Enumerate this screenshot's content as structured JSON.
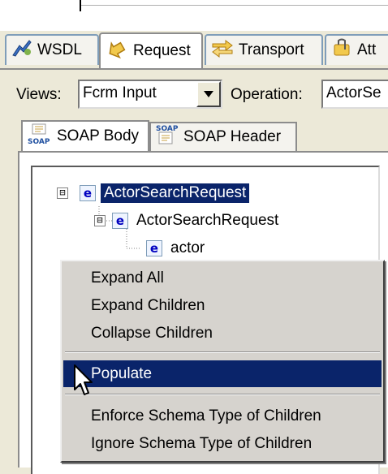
{
  "outer_tabs": [
    {
      "label": "WSDL",
      "icon": "wsdl-icon"
    },
    {
      "label": "Request",
      "icon": "request-icon",
      "active": true
    },
    {
      "label": "Transport",
      "icon": "transport-icon"
    },
    {
      "label": "Att",
      "icon": "attachments-icon"
    }
  ],
  "views": {
    "label": "Views:",
    "selected": "Fcrm Input",
    "operation_label": "Operation:",
    "operation_value": "ActorSe"
  },
  "inner_tabs": [
    {
      "label": "SOAP Body",
      "icon": "soap-icon",
      "active": true
    },
    {
      "label": "SOAP Header",
      "icon": "soap-icon"
    }
  ],
  "tree": {
    "root": {
      "label": "ActorSearchRequest",
      "expander": "⊟"
    },
    "child": {
      "label": "ActorSearchRequest",
      "expander": "⊟"
    },
    "grandchild": {
      "label": "actor"
    },
    "element_icon_glyph": "e"
  },
  "context_menu": {
    "items": [
      {
        "label": "Expand All"
      },
      {
        "label": "Expand Children"
      },
      {
        "label": "Collapse Children"
      },
      {
        "label": "Populate",
        "highlighted": true
      },
      {
        "label": "Enforce Schema Type of Children"
      },
      {
        "label": "Ignore Schema Type of Children"
      }
    ]
  },
  "colors": {
    "selection": "#0a246a",
    "window_bg": "#ece9d8",
    "menu_bg": "#d6d3ce"
  }
}
